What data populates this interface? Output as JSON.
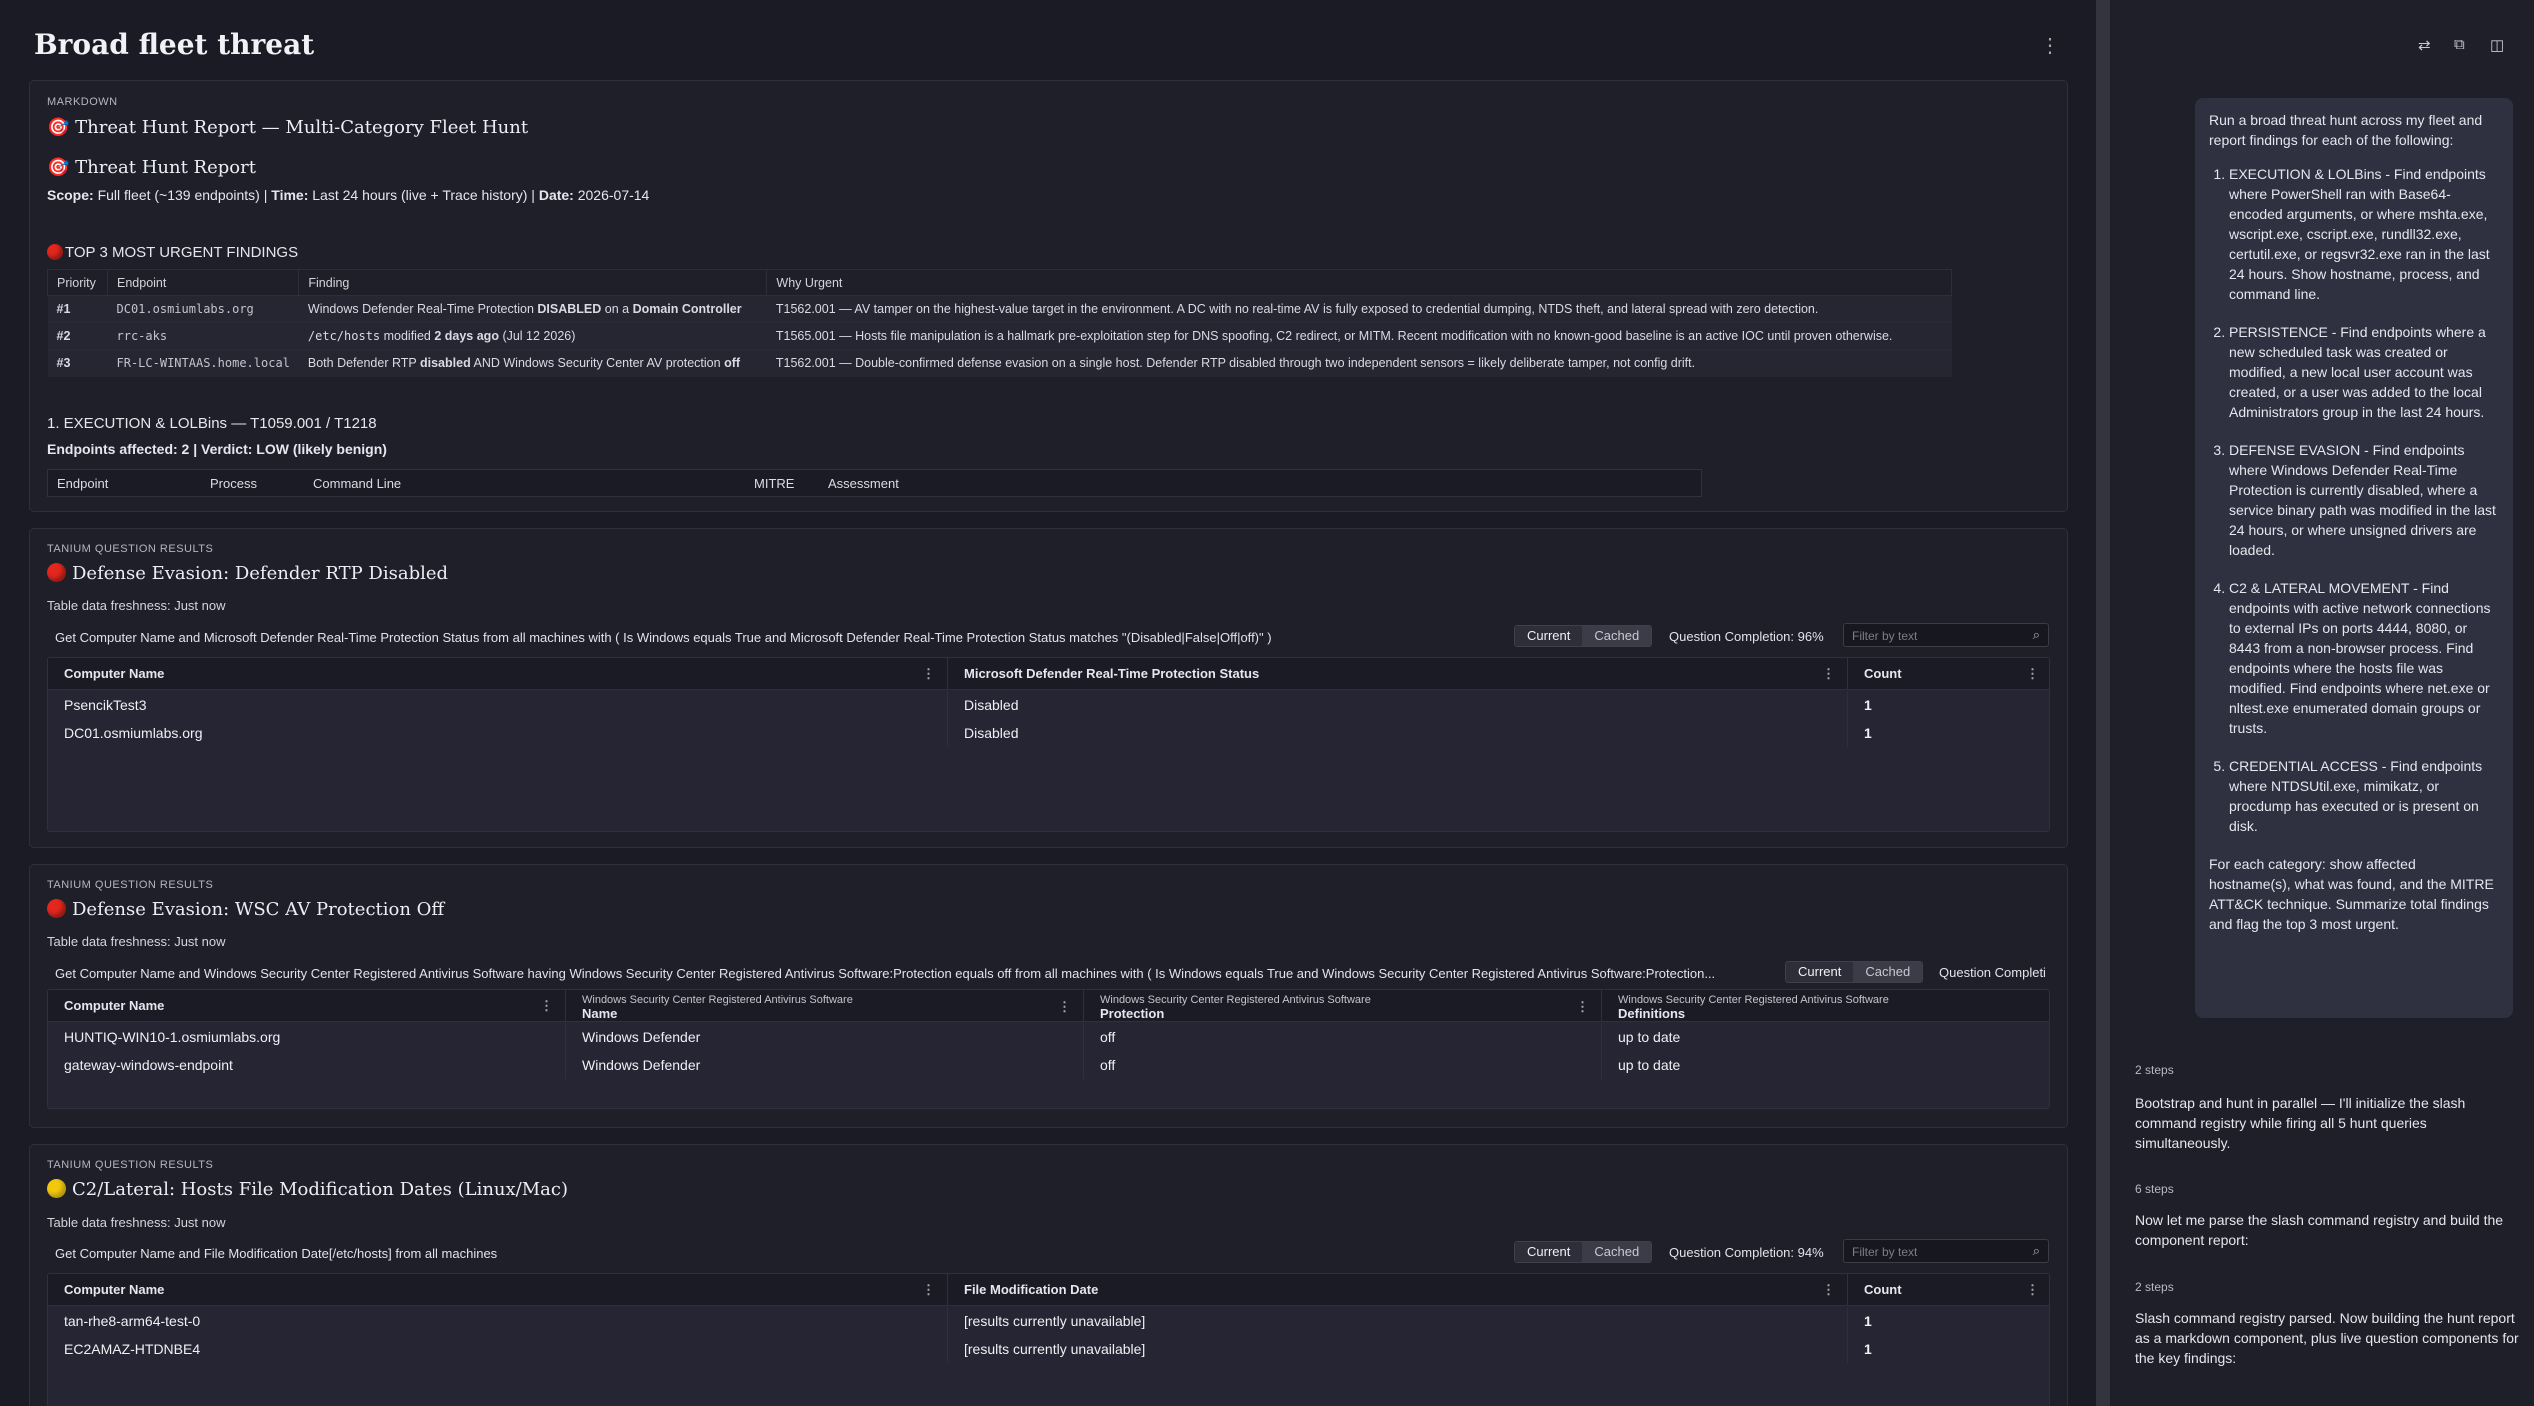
{
  "page": {
    "title": "Broad fleet threat"
  },
  "report": {
    "tag": "MARKDOWN",
    "h1": "Threat Hunt Report — Multi-Category Fleet Hunt",
    "h2": "Threat Hunt Report",
    "scope_label": "Scope:",
    "scope_value": "Full fleet (~139 endpoints) |",
    "time_label": "Time:",
    "time_value": "Last 24 hours (live + Trace history) |",
    "date_label": "Date:",
    "date_value": "2026-07-14",
    "top_title": "TOP 3 MOST URGENT FINDINGS",
    "findings_headers": [
      "Priority",
      "Endpoint",
      "Finding",
      "Why Urgent"
    ],
    "findings": [
      {
        "priority": "#1",
        "endpoint": "DC01.osmiumlabs.org",
        "f1": "Windows Defender Real-Time Protection ",
        "f2": "DISABLED",
        "f3": " on a ",
        "f4": "Domain Controller",
        "why": "T1562.001 — AV tamper on the highest-value target in the environment. A DC with no real-time AV is fully exposed to credential dumping, NTDS theft, and lateral spread with zero detection."
      },
      {
        "priority": "#2",
        "endpoint": "rrc-aks",
        "f1": "/etc/hosts",
        "f2": " modified ",
        "f3": "2 days ago",
        "f4": " (Jul 12 2026)",
        "why": "T1565.001 — Hosts file manipulation is a hallmark pre-exploitation step for DNS spoofing, C2 redirect, or MITM. Recent modification with no known-good baseline is an active IOC until proven otherwise."
      },
      {
        "priority": "#3",
        "endpoint": "FR-LC-WINTAAS.home.local",
        "f1": "Both Defender RTP ",
        "f2": "disabled",
        "f3": " AND Windows Security Center AV protection ",
        "f4": "off",
        "why": "T1562.001 — Double-confirmed defense evasion on a single host. Defender RTP disabled through two independent sensors = likely deliberate tamper, not config drift."
      }
    ],
    "section1_title": "1. EXECUTION & LOLBins — T1059.001 / T1218",
    "section1_sub": "Endpoints affected: 2 | Verdict: LOW (likely benign)",
    "section1_headers": [
      "Endpoint",
      "Process",
      "Command Line",
      "MITRE",
      "Assessment"
    ]
  },
  "panels": [
    {
      "tag": "TANIUM QUESTION RESULTS",
      "title": "Defense Evasion: Defender RTP Disabled",
      "severity": "red",
      "freshness": "Table data freshness: Just now",
      "question": "Get Computer Name and Microsoft Defender Real-Time Protection Status from all machines with ( Is Windows equals True and Microsoft Defender Real-Time Protection Status matches \"(Disabled|False|Off|off)\" )",
      "seg_current": "Current",
      "seg_cached": "Cached",
      "completion": "Question Completion:",
      "completion_pct": "96%",
      "filter_placeholder": "Filter by text",
      "columns": [
        "Computer Name",
        "Microsoft Defender Real-Time Protection Status",
        "Count"
      ],
      "rows": [
        [
          "PsencikTest3",
          "Disabled",
          "1"
        ],
        [
          "DC01.osmiumlabs.org",
          "Disabled",
          "1"
        ]
      ]
    },
    {
      "tag": "TANIUM QUESTION RESULTS",
      "title": "Defense Evasion: WSC AV Protection Off",
      "severity": "red",
      "freshness": "Table data freshness: Just now",
      "question": "Get Computer Name and Windows Security Center Registered Antivirus Software having Windows Security Center Registered Antivirus Software:Protection equals off from all machines with ( Is Windows equals True and Windows Security Center Registered Antivirus Software:Protection...",
      "seg_current": "Current",
      "seg_cached": "Cached",
      "completion": "Question Completi",
      "columns": [
        "Computer Name",
        "Name",
        "Protection",
        "Definitions"
      ],
      "column_group": "Windows Security Center Registered Antivirus Software",
      "rows": [
        [
          "HUNTIQ-WIN10-1.osmiumlabs.org",
          "Windows Defender",
          "off",
          "up to date"
        ],
        [
          "gateway-windows-endpoint",
          "Windows Defender",
          "off",
          "up to date"
        ]
      ]
    },
    {
      "tag": "TANIUM QUESTION RESULTS",
      "title": "C2/Lateral: Hosts File Modification Dates (Linux/Mac)",
      "severity": "yellow",
      "freshness": "Table data freshness: Just now",
      "question": "Get Computer Name and File Modification Date[/etc/hosts] from all machines",
      "seg_current": "Current",
      "seg_cached": "Cached",
      "completion": "Question Completion:",
      "completion_pct": "94%",
      "filter_placeholder": "Filter by text",
      "columns": [
        "Computer Name",
        "File Modification Date",
        "Count"
      ],
      "rows": [
        [
          "tan-rhe8-arm64-test-0",
          "[results currently unavailable]",
          "1"
        ],
        [
          "EC2AMAZ-HTDNBE4",
          "[results currently unavailable]",
          "1"
        ]
      ]
    }
  ],
  "chat": {
    "prompt_intro": "Run a broad threat hunt across my fleet and report findings for each of the following:",
    "prompt_items": [
      "EXECUTION & LOLBins - Find endpoints where PowerShell ran with Base64-encoded arguments, or where mshta.exe, wscript.exe, cscript.exe, rundll32.exe, certutil.exe, or regsvr32.exe ran in the last 24 hours. Show hostname, process, and command line.",
      "PERSISTENCE - Find endpoints where a new scheduled task was created or modified, a new local user account was created, or a user was added to the local Administrators group in the last 24 hours.",
      "DEFENSE EVASION - Find endpoints where Windows Defender Real-Time Protection is currently disabled, where a service binary path was modified in the last 24 hours, or where unsigned drivers are loaded.",
      "C2 & LATERAL MOVEMENT - Find endpoints with active network connections to external IPs on ports 4444, 8080, or 8443 from a non-browser process. Find endpoints where the hosts file was modified. Find endpoints where net.exe or nltest.exe enumerated domain groups or trusts.",
      "CREDENTIAL ACCESS - Find endpoints where NTDSUtil.exe, mimikatz, or procdump has executed or is present on disk."
    ],
    "prompt_outro": "For each category: show affected hostname(s), what was found, and the MITRE ATT&CK technique. Summarize total findings and flag the top 3 most urgent.",
    "steps": [
      {
        "count": "2 steps",
        "text": "Bootstrap and hunt in parallel — I'll initialize the slash command registry while firing all 5 hunt queries simultaneously."
      },
      {
        "count": "6 steps",
        "text": "Now let me parse the slash command registry and build the component report:"
      },
      {
        "count": "2 steps",
        "text": "Slash command registry parsed. Now building the hunt report as a markdown component, plus live question components for the key findings:"
      }
    ]
  }
}
